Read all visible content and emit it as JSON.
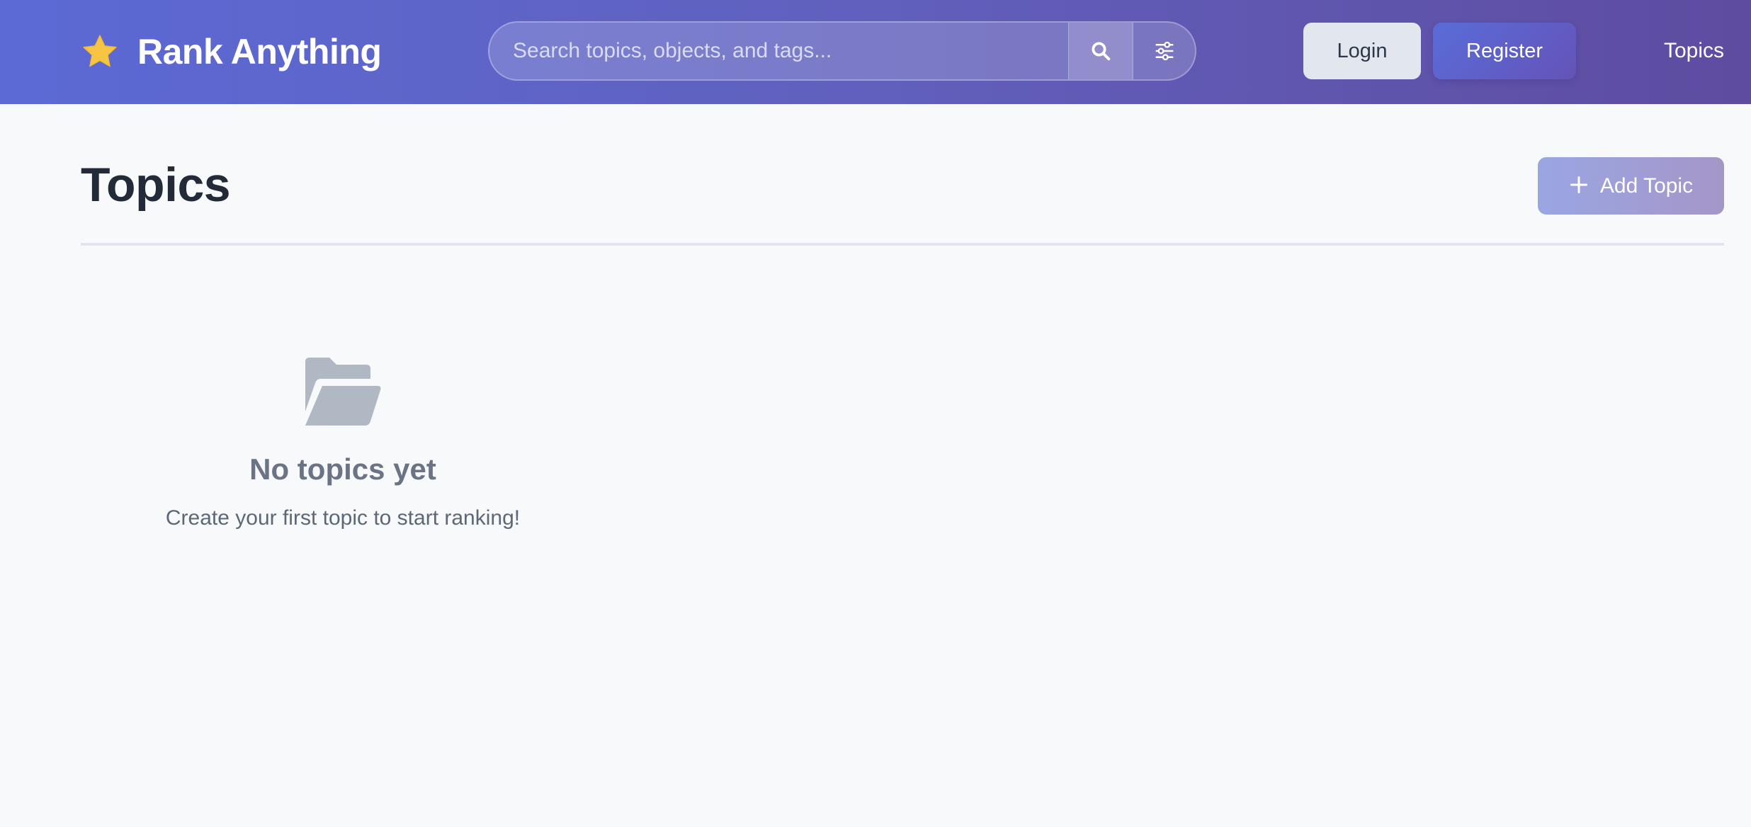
{
  "app": {
    "title": "Rank Anything",
    "logo_icon": "star-icon"
  },
  "search": {
    "placeholder": "Search topics, objects, and tags...",
    "value": "",
    "search_icon": "search-icon",
    "filter_icon": "sliders-icon"
  },
  "header_nav": {
    "login_label": "Login",
    "register_label": "Register",
    "topics_label": "Topics"
  },
  "page": {
    "title": "Topics",
    "add_button_label": "Add Topic",
    "add_button_icon": "plus-icon"
  },
  "empty_state": {
    "icon": "folder-open-icon",
    "title": "No topics yet",
    "message": "Create your first topic to start ranking!"
  },
  "colors": {
    "header_gradient_start": "#5b6ad5",
    "header_gradient_end": "#5e4ca0",
    "star": "#f6c544",
    "page_background": "#f7f9fb",
    "title_text": "#232b38",
    "empty_icon": "#b0b8c4"
  }
}
